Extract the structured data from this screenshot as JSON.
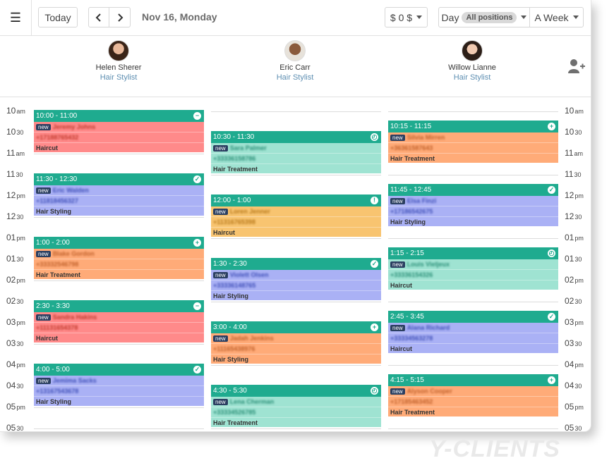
{
  "toolbar": {
    "today_label": "Today",
    "prev_icon": "chevron-left-icon",
    "next_icon": "chevron-right-icon",
    "date_label": "Nov 16, Monday",
    "revenue_label": "$ 0 $",
    "view_label": "Day",
    "positions_label": "All positions",
    "range_label": "A Week"
  },
  "staff": [
    {
      "name": "Helen Sherer",
      "role": "Hair Stylist"
    },
    {
      "name": "Eric Carr",
      "role": "Hair Stylist"
    },
    {
      "name": "Willow Lianne",
      "role": "Hair Stylist"
    }
  ],
  "add_staff_icon": "add-user-icon",
  "time_labels": [
    {
      "h": "10",
      "s": "am"
    },
    {
      "h": "10",
      "s": "30"
    },
    {
      "h": "11",
      "s": "am"
    },
    {
      "h": "11",
      "s": "30"
    },
    {
      "h": "12",
      "s": "pm"
    },
    {
      "h": "12",
      "s": "30"
    },
    {
      "h": "01",
      "s": "pm"
    },
    {
      "h": "01",
      "s": "30"
    },
    {
      "h": "02",
      "s": "pm"
    },
    {
      "h": "02",
      "s": "30"
    },
    {
      "h": "03",
      "s": "pm"
    },
    {
      "h": "03",
      "s": "30"
    },
    {
      "h": "04",
      "s": "pm"
    },
    {
      "h": "04",
      "s": "30"
    },
    {
      "h": "05",
      "s": "pm"
    },
    {
      "h": "05",
      "s": "30"
    }
  ],
  "columns": [
    {
      "appointments": [
        {
          "time": "10:00 - 11:00",
          "badge": "new",
          "client": "Jeremy Johns",
          "phone": "+17188765432",
          "service": "Haircut",
          "status_icon": "minus-icon",
          "color": "#ff8a8a",
          "text_color": "#c0392b"
        },
        {
          "time": "11:30 - 12:30",
          "badge": "new",
          "client": "Eric Walden",
          "phone": "+11818456327",
          "service": "Hair Styling",
          "status_icon": "check-icon",
          "color": "#aab1f5",
          "text_color": "#3f4fb8"
        },
        {
          "time": "1:00 - 2:00",
          "badge": "new",
          "client": "Blake Gordon",
          "phone": "+33332546798",
          "service": "Hair Treatment",
          "status_icon": "plus-icon",
          "color": "#ffab78",
          "text_color": "#c0602a"
        },
        {
          "time": "2:30 - 3:30",
          "badge": "new",
          "client": "Sandra Hakins",
          "phone": "+11131654378",
          "service": "Haircut",
          "status_icon": "minus-icon",
          "color": "#ff8a8a",
          "text_color": "#c0392b"
        },
        {
          "time": "4:00 - 5:00",
          "badge": "new",
          "client": "Jemima Sacks",
          "phone": "+13167543678",
          "service": "Hair Styling",
          "status_icon": "check-icon",
          "color": "#aab1f5",
          "text_color": "#3f4fb8"
        }
      ]
    },
    {
      "appointments": [
        {
          "time": "10:30 - 11:30",
          "badge": "new",
          "client": "Sara Palmer",
          "phone": "+33336158786",
          "service": "Hair Treatment",
          "status_icon": "clock-icon",
          "color": "#9fe3d2",
          "text_color": "#2a8f77"
        },
        {
          "time": "12:00 - 1:00",
          "badge": "new",
          "client": "Loren Jenner",
          "phone": "+11316765398",
          "service": "Haircut",
          "status_icon": "exclamation-icon",
          "color": "#f8c470",
          "text_color": "#b67718"
        },
        {
          "time": "1:30 - 2:30",
          "badge": "new",
          "client": "Violett Olsen",
          "phone": "+33336148765",
          "service": "Hair Styling",
          "status_icon": "check-icon",
          "color": "#aab1f5",
          "text_color": "#3f4fb8"
        },
        {
          "time": "3:00 - 4:00",
          "badge": "new",
          "client": "Jadah Jenkins",
          "phone": "+11165438976",
          "service": "Hair Styling",
          "status_icon": "plus-icon",
          "color": "#ffab78",
          "text_color": "#c0602a"
        },
        {
          "time": "4:30 - 5:30",
          "badge": "new",
          "client": "Lena Cherman",
          "phone": "+33334526785",
          "service": "Hair Treatment",
          "status_icon": "clock-icon",
          "color": "#9fe3d2",
          "text_color": "#2a8f77"
        }
      ]
    },
    {
      "appointments": [
        {
          "time": "10:15 - 11:15",
          "badge": "new",
          "client": "Silvia Mirren",
          "phone": "+36361587643",
          "service": "Hair Treatment",
          "status_icon": "plus-icon",
          "color": "#ffab78",
          "text_color": "#c0602a"
        },
        {
          "time": "11:45 - 12:45",
          "badge": "new",
          "client": "Elsa Finzi",
          "phone": "+17186542675",
          "service": "Hair Styling",
          "status_icon": "check-icon",
          "color": "#aab1f5",
          "text_color": "#3f4fb8"
        },
        {
          "time": "1:15 - 2:15",
          "badge": "new",
          "client": "Louis Vieljeux",
          "phone": "+33336154326",
          "service": "Haircut",
          "status_icon": "clock-icon",
          "color": "#9fe3d2",
          "text_color": "#2a8f77"
        },
        {
          "time": "2:45 - 3:45",
          "badge": "new",
          "client": "Alana Richard",
          "phone": "+33334563278",
          "service": "Haircut",
          "status_icon": "check-icon",
          "color": "#aab1f5",
          "text_color": "#3f4fb8"
        },
        {
          "time": "4:15 - 5:15",
          "badge": "new",
          "client": "Alyson Cooper",
          "phone": "+17185463452",
          "service": "Hair Treatment",
          "status_icon": "plus-icon",
          "color": "#ffab78",
          "text_color": "#c0602a"
        }
      ]
    }
  ],
  "watermark": "Y-CLIENTS"
}
